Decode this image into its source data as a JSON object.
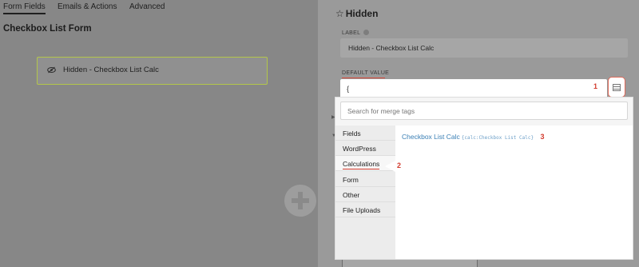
{
  "tabs": [
    {
      "label": "Form Fields"
    },
    {
      "label": "Emails & Actions"
    },
    {
      "label": "Advanced"
    }
  ],
  "form": {
    "title": "Checkbox List Form",
    "field_label": "Hidden - Checkbox List Calc"
  },
  "drawer": {
    "title": "Hidden",
    "label_heading": "LABEL",
    "label_value": "Hidden - Checkbox List Calc",
    "default_heading": "DEFAULT VALUE",
    "default_value": "{"
  },
  "merge_tags": {
    "search_placeholder": "Search for merge tags",
    "categories": [
      {
        "label": "Fields"
      },
      {
        "label": "WordPress"
      },
      {
        "label": "Calculations"
      },
      {
        "label": "Form"
      },
      {
        "label": "Other"
      },
      {
        "label": "File Uploads"
      }
    ],
    "active_category": "Calculations",
    "tags": [
      {
        "label": "Checkbox List Calc",
        "code": "{calc:Checkbox List Calc}"
      }
    ]
  },
  "annotations": [
    "1",
    "2",
    "3"
  ],
  "colors": {
    "accent_red": "#d23b2e",
    "link_blue": "#3a7fb5",
    "field_border": "#b3c64a"
  }
}
